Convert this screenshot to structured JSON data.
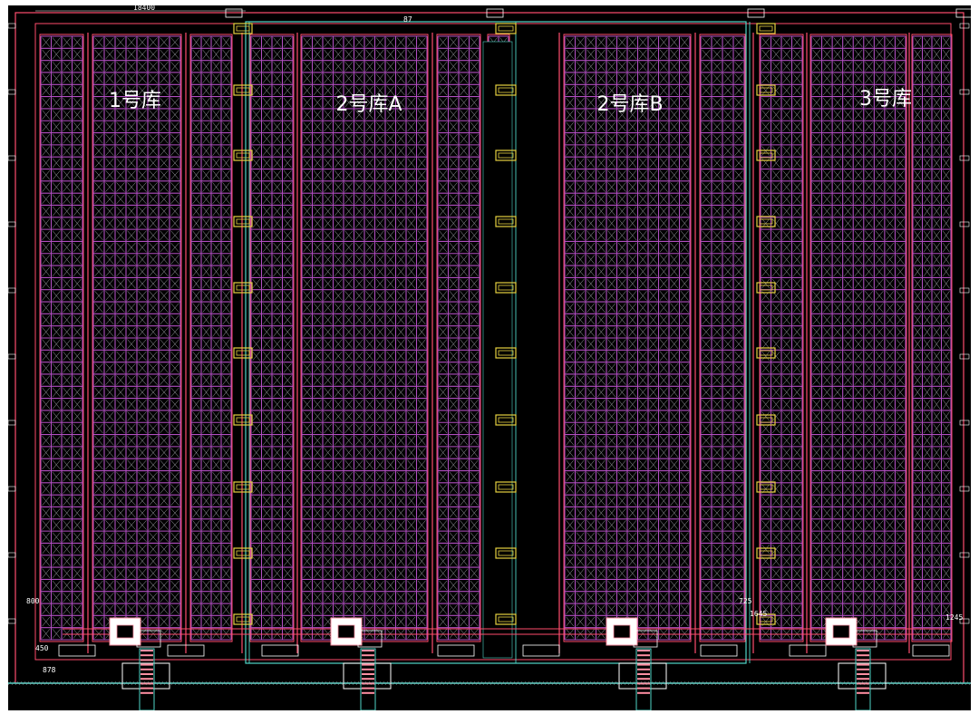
{
  "drawing": {
    "warehouses": [
      {
        "id": "wh1",
        "label": "1号库"
      },
      {
        "id": "wh2a",
        "label": "2号库A"
      },
      {
        "id": "wh2b",
        "label": "2号库B"
      },
      {
        "id": "wh3",
        "label": "3号库"
      }
    ],
    "dimensions": {
      "top_width": "18400",
      "top_center": "87",
      "left_vertical": "800",
      "left_lower_1": "450",
      "left_lower_2": "878",
      "right_1": "725",
      "right_2": "1645",
      "right_3": "1245"
    },
    "colors": {
      "background": "#000000",
      "rack_bay": "#b04fc0",
      "rack_frame": "#ff4d6d",
      "outline": "#4fd6c7",
      "station": "#e6d040",
      "text": "#ffffff"
    }
  }
}
